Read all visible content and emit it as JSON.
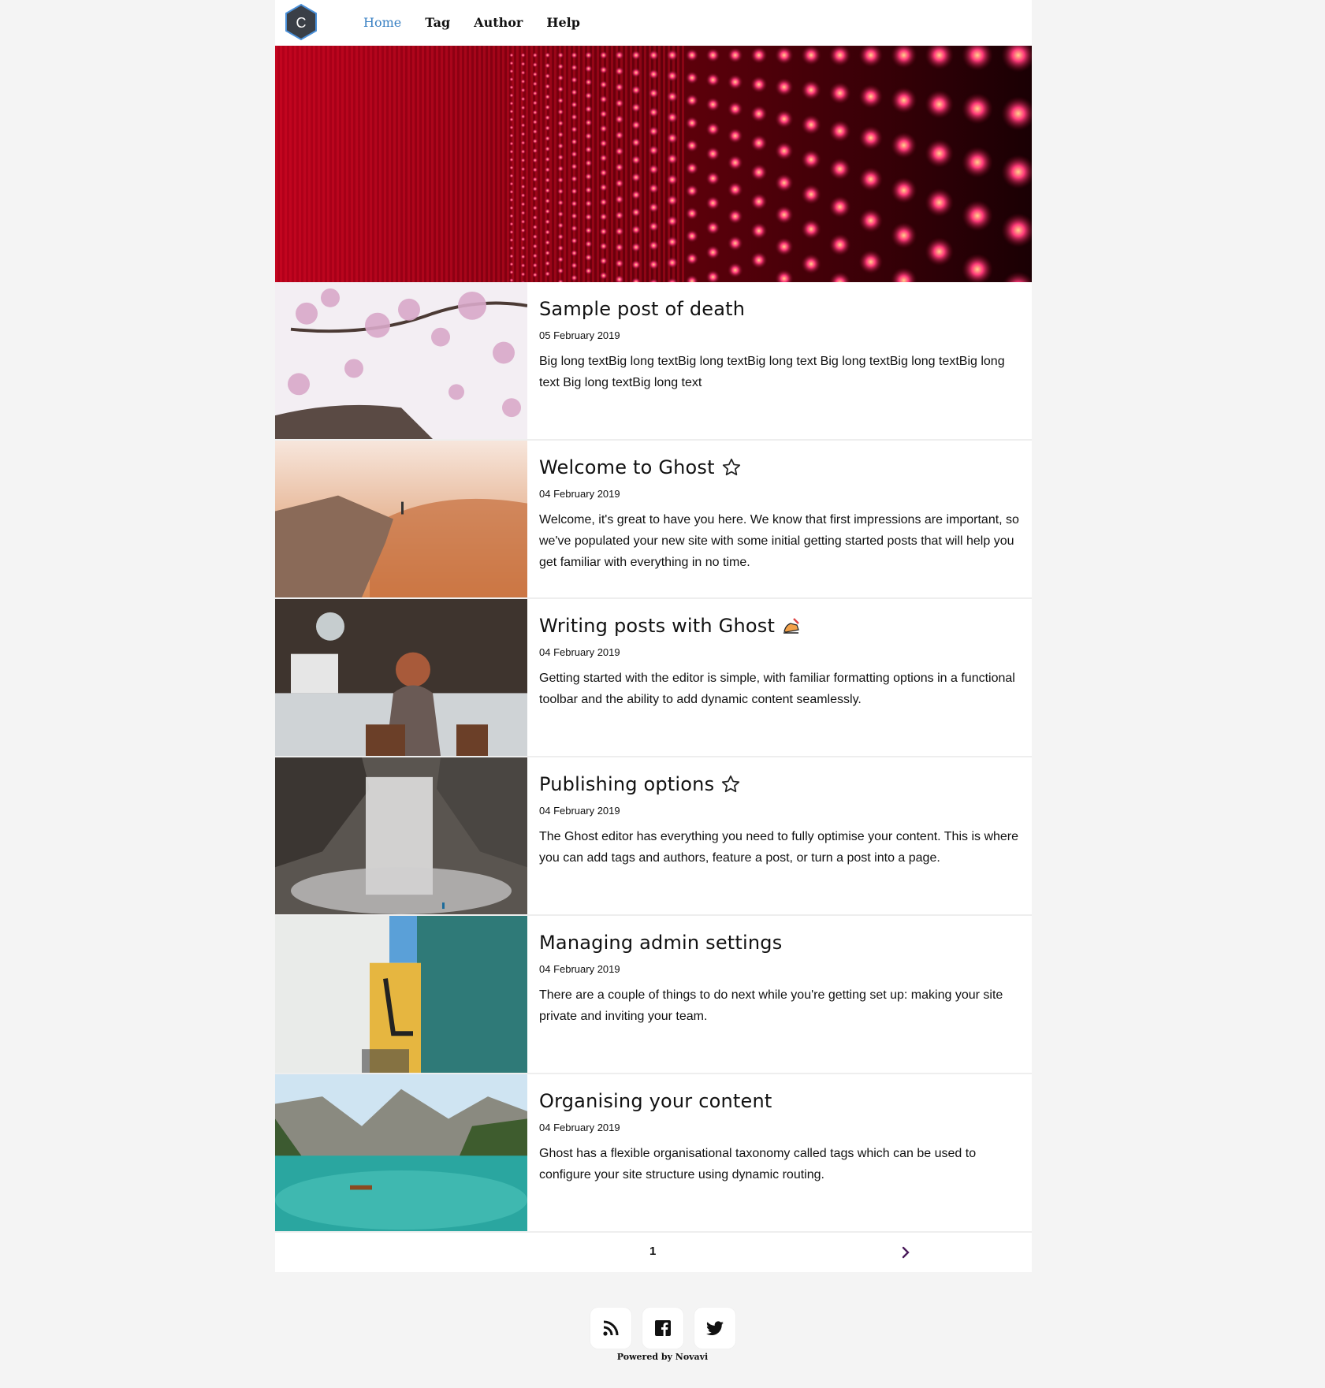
{
  "logo": {
    "letter": "C",
    "color": "#3a3f47",
    "border": "#4a90d9"
  },
  "nav": {
    "items": [
      {
        "label": "Home",
        "active": true
      },
      {
        "label": "Tag",
        "active": false
      },
      {
        "label": "Author",
        "active": false
      },
      {
        "label": "Help",
        "active": false
      }
    ]
  },
  "posts": [
    {
      "title": "Sample post of death",
      "date": "05 February 2019",
      "excerpt": "Big long textBig long textBig long textBig long text Big long textBig long textBig long text Big long textBig long text",
      "icon": ""
    },
    {
      "title": "Welcome to Ghost",
      "date": "04 February 2019",
      "excerpt": "Welcome, it's great to have you here. We know that first impressions are important, so we've populated your new site with some initial getting started posts that will help you get familiar with everything in no time.",
      "icon": "star-icon"
    },
    {
      "title": "Writing posts with Ghost",
      "date": "04 February 2019",
      "excerpt": "Getting started with the editor is simple, with familiar formatting options in a functional toolbar and the ability to add dynamic content seamlessly.",
      "icon": "writing-hand-icon"
    },
    {
      "title": "Publishing options",
      "date": "04 February 2019",
      "excerpt": "The Ghost editor has everything you need to fully optimise your content. This is where you can add tags and authors, feature a post, or turn a post into a page.",
      "icon": "star-icon"
    },
    {
      "title": "Managing admin settings",
      "date": "04 February 2019",
      "excerpt": "There are a couple of things to do next while you're getting set up: making your site private and inviting your team.",
      "icon": ""
    },
    {
      "title": "Organising your content",
      "date": "04 February 2019",
      "excerpt": "Ghost has a flexible organisational taxonomy called tags which can be used to configure your site structure using dynamic routing.",
      "icon": ""
    }
  ],
  "pagination": {
    "current": "1",
    "next_icon": "chevron-right-icon"
  },
  "footer": {
    "social": [
      "rss-icon",
      "facebook-icon",
      "twitter-icon"
    ],
    "powered": "Powered by Novavi"
  }
}
